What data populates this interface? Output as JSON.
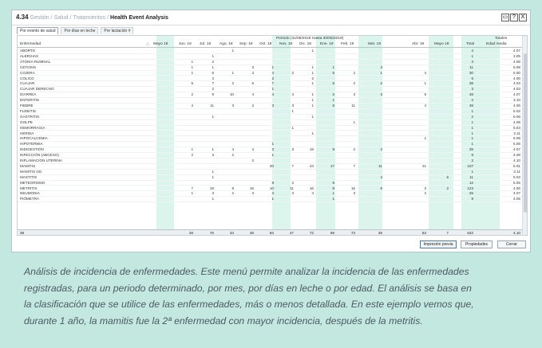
{
  "window": {
    "number": "4.34",
    "crumbs": [
      "Gestión",
      "Salud",
      "Tratamientos"
    ],
    "title": "Health Event Analysis",
    "buttons": [
      "▭",
      "?",
      "X"
    ]
  },
  "tabs": [
    "Por evento de salud",
    "Por días en leche",
    "Por lactación #"
  ],
  "grid": {
    "period_label": "Periodo (31/05/2018 Hasta 30/05/2019)",
    "totals_label": "Totales",
    "name_header": "Enfermedad",
    "sort_marker": "△",
    "months": [
      "Mayo 18",
      "Jun. 18",
      "Jul. 18",
      "Ago. 18",
      "Sep. 18",
      "Oct. 18",
      "Nov. 18",
      "Dic. 18",
      "Ene. 19",
      "Feb. 19",
      "Mar. 19",
      "Abr. 19",
      "Mayo 19"
    ],
    "total_headers": [
      "Total",
      "Edad media"
    ],
    "rows": [
      {
        "name": "ABORTO",
        "m": [
          "",
          "",
          "",
          "1",
          "",
          "",
          "",
          "1",
          "",
          "",
          "",
          "",
          ""
        ],
        "total": "4",
        "age": "4.07"
      },
      {
        "name": "ALERGIAS",
        "m": [
          "",
          "",
          "1",
          "",
          "",
          "",
          "",
          "",
          "",
          "",
          "",
          "",
          ""
        ],
        "total": "1",
        "age": "3.05"
      },
      {
        "name": "ATONIA RUMINAL",
        "m": [
          "",
          "1",
          "2",
          "",
          "",
          "",
          "",
          "",
          "",
          "",
          "",
          "",
          ""
        ],
        "total": "3",
        "age": "4.06"
      },
      {
        "name": "CETOSIS",
        "m": [
          "",
          "1",
          "1",
          "",
          "3",
          "1",
          "",
          "1",
          "1",
          "",
          "3",
          "",
          ""
        ],
        "total": "11",
        "age": "5.08"
      },
      {
        "name": "COJERA",
        "m": [
          "",
          "1",
          "6",
          "1",
          "3",
          "4",
          "2",
          "1",
          "5",
          "2",
          "1",
          "4",
          ""
        ],
        "total": "30",
        "age": "5.00"
      },
      {
        "name": "COLICO",
        "m": [
          "",
          "",
          "2",
          "",
          "",
          "2",
          "",
          "2",
          "",
          "",
          "",
          "",
          ""
        ],
        "total": "6",
        "age": "4.00"
      },
      {
        "name": "CUAJAR",
        "m": [
          "",
          "5",
          "7",
          "2",
          "6",
          "7",
          "",
          "1",
          "5",
          "2",
          "2",
          "1",
          ""
        ],
        "total": "38",
        "age": "4.03"
      },
      {
        "name": "CUAJAR DERECHO",
        "m": [
          "",
          "",
          "2",
          "",
          "",
          "1",
          "",
          "",
          "",
          "",
          "",
          "",
          ""
        ],
        "total": "3",
        "age": "4.03"
      },
      {
        "name": "DIARREA",
        "m": [
          "",
          "2",
          "9",
          "10",
          "4",
          "4",
          "4",
          "1",
          "2",
          "3",
          "3",
          "5",
          ""
        ],
        "total": "49",
        "age": "4.07"
      },
      {
        "name": "ENTERITIS",
        "m": [
          "",
          "",
          "",
          "",
          "",
          "",
          "",
          "1",
          "1",
          "",
          "",
          "",
          ""
        ],
        "total": "2",
        "age": "3.10"
      },
      {
        "name": "FIEBRE",
        "m": [
          "",
          "4",
          "11",
          "3",
          "2",
          "3",
          "3",
          "1",
          "6",
          "11",
          "",
          "4",
          ""
        ],
        "total": "48",
        "age": "4.06"
      },
      {
        "name": "FLEBITIS",
        "m": [
          "",
          "",
          "",
          "",
          "",
          "",
          "1",
          "",
          "",
          "",
          "",
          "",
          ""
        ],
        "total": "1",
        "age": "5.02"
      },
      {
        "name": "GASTRITIS",
        "m": [
          "",
          "",
          "1",
          "",
          "",
          "",
          "",
          "1",
          "",
          "",
          "",
          "",
          ""
        ],
        "total": "2",
        "age": "5.06"
      },
      {
        "name": "GOLPE",
        "m": [
          "",
          "",
          "",
          "",
          "",
          "",
          "",
          "",
          "",
          "1",
          "",
          "",
          ""
        ],
        "total": "1",
        "age": "4.08"
      },
      {
        "name": "HEMORRAGIA",
        "m": [
          "",
          "",
          "",
          "",
          "",
          "",
          "1",
          "",
          "",
          "",
          "",
          "",
          ""
        ],
        "total": "1",
        "age": "5.04"
      },
      {
        "name": "HERIDA",
        "m": [
          "",
          "",
          "",
          "",
          "",
          "",
          "",
          "1",
          "",
          "",
          "",
          "",
          ""
        ],
        "total": "1",
        "age": "2.11"
      },
      {
        "name": "HIPOCALCEMIA",
        "m": [
          "",
          "",
          "",
          "",
          "",
          "",
          "",
          "",
          "",
          "",
          "",
          "1",
          ""
        ],
        "total": "1",
        "age": "6.08"
      },
      {
        "name": "HIPOTERMIA",
        "m": [
          "",
          "",
          "",
          "",
          "",
          "1",
          "",
          "",
          "",
          "",
          "",
          "",
          ""
        ],
        "total": "1",
        "age": "5.06"
      },
      {
        "name": "INDIGESTIÓN",
        "m": [
          "",
          "1",
          "1",
          "4",
          "4",
          "3",
          "3",
          "19",
          "9",
          "2",
          "2",
          "",
          ""
        ],
        "total": "39",
        "age": "4.07"
      },
      {
        "name": "INFECCIÓN (ABCESO)",
        "m": [
          "",
          "2",
          "3",
          "2",
          "",
          "1",
          "",
          "",
          "",
          "",
          "",
          "",
          ""
        ],
        "total": "8",
        "age": "4.08"
      },
      {
        "name": "INFLAMACION UTERINA",
        "m": [
          "",
          "",
          "",
          "",
          "2",
          "",
          "",
          "",
          "",
          "",
          "",
          "",
          ""
        ],
        "total": "2",
        "age": "4.10"
      },
      {
        "name": "MAMITIS",
        "m": [
          "",
          "",
          "",
          "",
          "",
          "20",
          "7",
          "24",
          "17",
          "7",
          "11",
          "21",
          ""
        ],
        "total": "107",
        "age": "5.01"
      },
      {
        "name": "MAMITIS GD",
        "m": [
          "",
          "",
          "1",
          "",
          "",
          "",
          "",
          "",
          "",
          "",
          "",
          "",
          ""
        ],
        "total": "1",
        "age": "3.11"
      },
      {
        "name": "MASTITIS",
        "m": [
          "",
          "",
          "1",
          "",
          "",
          "",
          "",
          "",
          "",
          "",
          "4",
          "",
          "5"
        ],
        "total": "11",
        "age": "5.03"
      },
      {
        "name": "METEORISMO",
        "m": [
          "",
          "",
          "",
          "",
          "",
          "8",
          "2",
          "",
          "5",
          "",
          "",
          "",
          ""
        ],
        "total": "12",
        "age": "5.05"
      },
      {
        "name": "METRITIS",
        "m": [
          "",
          "7",
          "19",
          "8",
          "15",
          "10",
          "11",
          "16",
          "8",
          "16",
          "6",
          "3",
          "2"
        ],
        "total": "123",
        "age": "4.06"
      },
      {
        "name": "NEUMONIA",
        "m": [
          "",
          "1",
          "3",
          "2",
          "3",
          "3",
          "3",
          "4",
          "1",
          "3",
          "",
          "2",
          ""
        ],
        "total": "25",
        "age": "4.07"
      },
      {
        "name": "PIÓMETRA",
        "m": [
          "",
          "",
          "1",
          "",
          "",
          "1",
          "",
          "",
          "1",
          "",
          "",
          "",
          ""
        ],
        "total": "9",
        "age": "4.05"
      }
    ],
    "footer": {
      "count": "39",
      "months": [
        "",
        "29",
        "76",
        "34",
        "49",
        "84",
        "47",
        "72",
        "69",
        "73",
        "39",
        "53",
        "7"
      ],
      "total": "632",
      "age": "4.10"
    }
  },
  "actions": [
    "Impresión previa",
    "Propiedades",
    "Cerrar"
  ],
  "caption": [
    "Análisis de incidencia de enfermedades. Este menú permite analizar la incidencia de las enfermedades",
    "registradas, para un periodo determinado, por mes, por días en leche o por edad. El análisis se basa en",
    "la clasificación que se utilice de las enfermedades, más o menos detallada. En este ejemplo vemos que,",
    "durante 1 año, la mamitis fue la 2ª enfermedad con mayor incidencia, después de la metritis."
  ],
  "colors": {
    "background": "#c3e8df",
    "band": "#dbf5ed",
    "caption_text": "#4b5a61"
  }
}
